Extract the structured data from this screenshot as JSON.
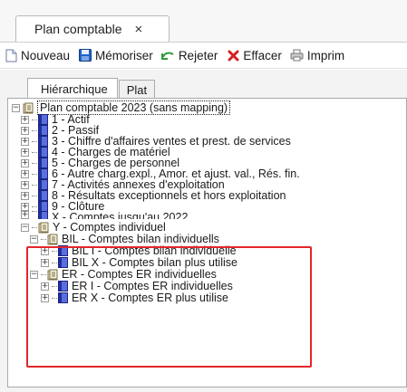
{
  "doc_tab": {
    "title": "Plan comptable",
    "close": "×"
  },
  "toolbar": {
    "new_label": "Nouveau",
    "save_label": "Mémoriser",
    "reject_label": "Rejeter",
    "clear_label": "Effacer",
    "print_label": "Imprim"
  },
  "view_tabs": {
    "hierarchical": "Hiérarchique",
    "flat": "Plat"
  },
  "tree": {
    "root": "Plan comptable 2023 (sans mapping)",
    "top_items": [
      "1 - Actif",
      "2 - Passif",
      "3 - Chiffre d'affaires ventes et prest. de services",
      "4 - Charges de matériel",
      "5 - Charges de personnel",
      "6 - Autre charg.expl., Amor. et ajust. val., Rés. fin.",
      "7 - Activités annexes d'exploitation",
      "8 - Résultats exceptionnels et hors exploitation",
      "9 - Clôture",
      "X - Comptes jusqu'au 2022"
    ],
    "individual": {
      "label": "Y - Comptes individuel",
      "bil": {
        "label": "BIL - Comptes bilan individuells",
        "children": [
          "BIL I - Comptes bilan individuelle",
          "BIL X - Comptes bilan plus utilise"
        ]
      },
      "er": {
        "label": "ER - Comptes ER individuelles",
        "children": [
          "ER I - Comptes ER individuelles",
          "ER X - Comptes ER plus utilise"
        ]
      }
    }
  },
  "colors": {
    "highlight": "#e3262b",
    "book": "#3346c9",
    "clear_icon": "#d42020",
    "save_icon": "#1e63c6"
  }
}
